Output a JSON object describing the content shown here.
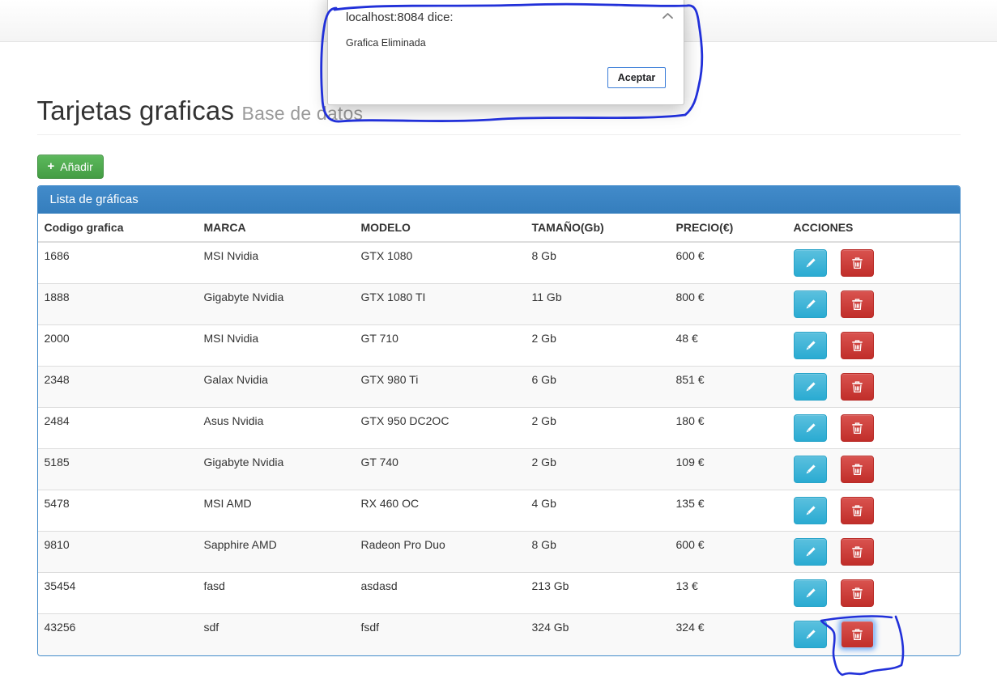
{
  "browser_dialog": {
    "title": "localhost:8084 dice:",
    "message": "Grafica Eliminada",
    "accept_button": "Aceptar"
  },
  "header": {
    "title": "Tarjetas graficas",
    "subtitle": "Base de datos"
  },
  "toolbar": {
    "plus_icon": "+",
    "add_button": "Añadir"
  },
  "panel": {
    "heading": "Lista de gráficas"
  },
  "table": {
    "columns": [
      "Codigo grafica",
      "MARCA",
      "MODELO",
      "TAMAÑO(Gb)",
      "PRECIO(€)",
      "ACCIONES"
    ],
    "rows": [
      {
        "codigo": "1686",
        "marca": "MSI Nvidia",
        "modelo": "GTX 1080",
        "tamano": "8 Gb",
        "precio": "600 €"
      },
      {
        "codigo": "1888",
        "marca": "Gigabyte Nvidia",
        "modelo": "GTX 1080 TI",
        "tamano": "11 Gb",
        "precio": "800 €"
      },
      {
        "codigo": "2000",
        "marca": "MSI Nvidia",
        "modelo": "GT 710",
        "tamano": "2 Gb",
        "precio": "48 €"
      },
      {
        "codigo": "2348",
        "marca": "Galax Nvidia",
        "modelo": "GTX 980 Ti",
        "tamano": "6 Gb",
        "precio": "851 €"
      },
      {
        "codigo": "2484",
        "marca": "Asus Nvidia",
        "modelo": "GTX 950 DC2OC",
        "tamano": "2 Gb",
        "precio": "180 €"
      },
      {
        "codigo": "5185",
        "marca": "Gigabyte Nvidia",
        "modelo": "GT 740",
        "tamano": "2 Gb",
        "precio": "109 €"
      },
      {
        "codigo": "5478",
        "marca": "MSI AMD",
        "modelo": "RX 460 OC",
        "tamano": "4 Gb",
        "precio": "135 €"
      },
      {
        "codigo": "9810",
        "marca": "Sapphire AMD",
        "modelo": "Radeon Pro Duo",
        "tamano": "8 Gb",
        "precio": "600 €"
      },
      {
        "codigo": "35454",
        "marca": "fasd",
        "modelo": "asdasd",
        "tamano": "213 Gb",
        "precio": "13 €"
      },
      {
        "codigo": "43256",
        "marca": "sdf",
        "modelo": "fsdf",
        "tamano": "324 Gb",
        "precio": "324 €"
      }
    ],
    "focused_delete_row": 9
  },
  "colors": {
    "panel_blue": "#428bca",
    "success_green": "#5cb85c",
    "info_cyan": "#5bc0de",
    "danger_red": "#d9534f",
    "annotation_ink": "#2130d9"
  }
}
